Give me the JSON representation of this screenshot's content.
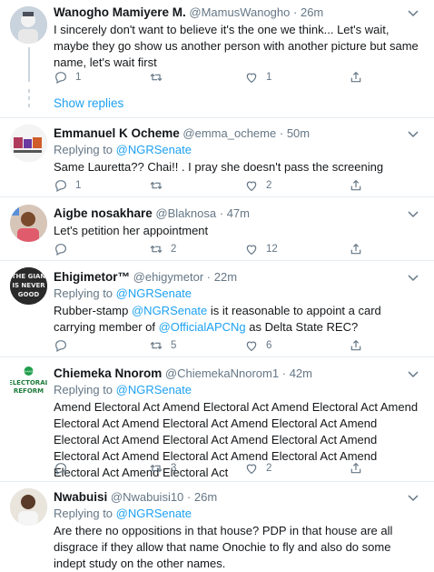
{
  "accent_color": "#1da1f2",
  "muted_color": "#657786",
  "tweets": [
    {
      "name": "Wanogho Mamiyere M.",
      "handle": "@MamusWanogho",
      "time": "26m",
      "reply_prefix": "",
      "reply_to": "",
      "text": "I sincerely don't want to believe it's the one we think... Let's wait, maybe they go show us another person with another picture but same name, let's wait first",
      "counts": {
        "reply": "1",
        "retweet": "",
        "like": "1"
      }
    },
    {
      "name": "Emmanuel K Ocheme",
      "handle": "@emma_ocheme",
      "time": "50m",
      "reply_prefix": "Replying to",
      "reply_to": "@NGRSenate",
      "text": "Same Lauretta?? Chai!! . I pray she doesn't pass the screening",
      "counts": {
        "reply": "1",
        "retweet": "",
        "like": "2"
      }
    },
    {
      "name": "Aigbe nosakhare",
      "handle": "@Blaknosa",
      "time": "47m",
      "reply_prefix": "",
      "reply_to": "",
      "text": "Let's petition her appointment",
      "counts": {
        "reply": "",
        "retweet": "2",
        "like": "12"
      }
    },
    {
      "name": "Ehigimetor™",
      "handle": "@ehigymetor",
      "time": "22m",
      "reply_prefix": "Replying to",
      "reply_to": "@NGRSenate",
      "text_parts": [
        "Rubber-stamp ",
        "@NGRSenate",
        " is it reasonable to appoint a card carrying member of ",
        "@OfficialAPCNg",
        " as Delta State REC?"
      ],
      "counts": {
        "reply": "",
        "retweet": "5",
        "like": "6"
      }
    },
    {
      "name": "Chiemeka Nnorom",
      "handle": "@ChiemekaNnorom1",
      "time": "42m",
      "reply_prefix": "Replying to",
      "reply_to": "@NGRSenate",
      "text": "Amend Electoral Act Amend Electoral Act Amend Electoral Act Amend Electoral Act Amend Electoral Act Amend Electoral Act Amend Electoral Act Amend Electoral Act Amend Electoral Act Amend Electoral Act Amend Electoral Act Amend Electoral Act Amend Electoral Act Amend Electoral Act",
      "counts": {
        "reply": "",
        "retweet": "3",
        "like": "2"
      }
    },
    {
      "name": "Nwabuisi",
      "handle": "@Nwabuisi10",
      "time": "26m",
      "reply_prefix": "Replying to",
      "reply_to": "@NGRSenate",
      "text": "Are there no oppositions in that house? PDP in that house are all disgrace if they allow that name Onochie to fly and also do some indept study on the other names.",
      "counts": {
        "reply": "",
        "retweet": "",
        "like": ""
      }
    }
  ],
  "show_replies": "Show replies",
  "dot": "·",
  "avatar_texts": {
    "t4": [
      "THE GIAN",
      "IS NEVER",
      "GOOD"
    ],
    "t5_top": "CHANGE",
    "t5_bottom": [
      "ELECTORAL",
      "REFORM"
    ]
  }
}
